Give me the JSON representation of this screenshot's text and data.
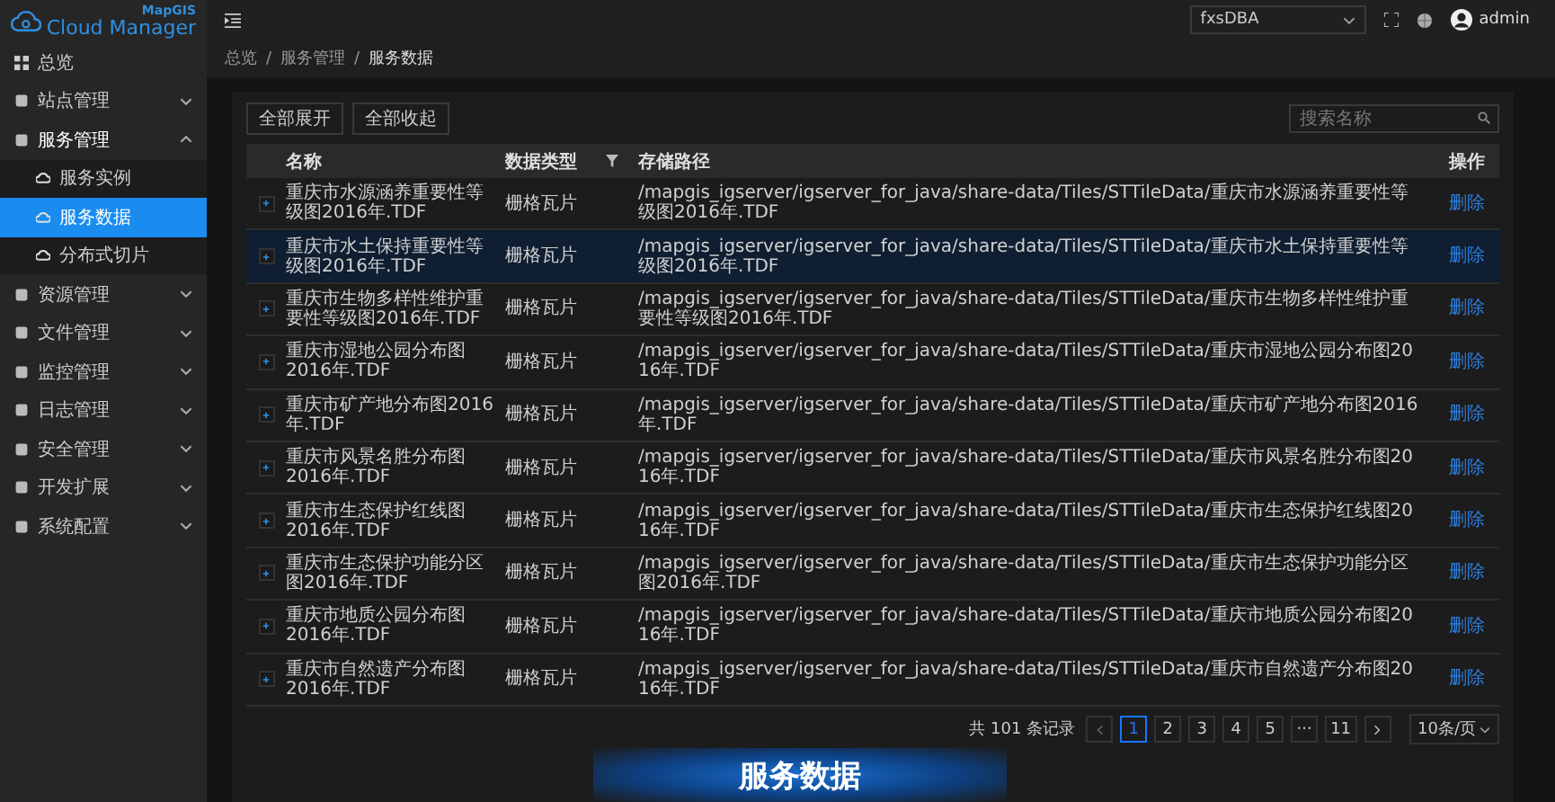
{
  "logo": {
    "brand": "MapGIS",
    "product": "Cloud Manager"
  },
  "sidebar": {
    "items": [
      {
        "label": "总览",
        "selected": false
      },
      {
        "label": "站点管理",
        "expanded": false,
        "selected": false
      },
      {
        "label": "服务管理",
        "expanded": true,
        "selected": false,
        "children": [
          {
            "label": "服务实例",
            "selected": false
          },
          {
            "label": "服务数据",
            "selected": true
          },
          {
            "label": "分布式切片",
            "selected": false
          }
        ]
      },
      {
        "label": "资源管理",
        "expanded": false,
        "selected": false
      },
      {
        "label": "文件管理",
        "expanded": false,
        "selected": false
      },
      {
        "label": "监控管理",
        "expanded": false,
        "selected": false
      },
      {
        "label": "日志管理",
        "expanded": false,
        "selected": false
      },
      {
        "label": "安全管理",
        "expanded": false,
        "selected": false
      },
      {
        "label": "开发扩展",
        "expanded": false,
        "selected": false
      },
      {
        "label": "系统配置",
        "expanded": false,
        "selected": false
      }
    ]
  },
  "header": {
    "select_value": "fxsDBA",
    "user": "admin"
  },
  "breadcrumb": [
    "总览",
    "服务管理",
    "服务数据"
  ],
  "breadcrumb_separator": "/",
  "toolbar": {
    "buttons": [
      "全部展开",
      "全部收起"
    ],
    "search": {
      "placeholder": "搜索名称"
    }
  },
  "table": {
    "columns": [
      "名称",
      "数据类型",
      "存储路径",
      "操作"
    ],
    "rows": [
      {
        "name": "重庆市水源涵养重要性等级图2016年.TDF",
        "type": "栅格瓦片",
        "path": "/mapgis_igserver/igserver_for_java/share-data/Tiles/STTileData/重庆市水源涵养重要性等级图2016年.TDF",
        "action": "删除",
        "selected": false
      },
      {
        "name": "重庆市水土保持重要性等级图2016年.TDF",
        "type": "栅格瓦片",
        "path": "/mapgis_igserver/igserver_for_java/share-data/Tiles/STTileData/重庆市水土保持重要性等级图2016年.TDF",
        "action": "删除",
        "selected": true
      },
      {
        "name": "重庆市生物多样性维护重要性等级图2016年.TDF",
        "type": "栅格瓦片",
        "path": "/mapgis_igserver/igserver_for_java/share-data/Tiles/STTileData/重庆市生物多样性维护重要性等级图2016年.TDF",
        "action": "删除",
        "selected": false
      },
      {
        "name": "重庆市湿地公园分布图2016年.TDF",
        "type": "栅格瓦片",
        "path": "/mapgis_igserver/igserver_for_java/share-data/Tiles/STTileData/重庆市湿地公园分布图2016年.TDF",
        "action": "删除",
        "selected": false
      },
      {
        "name": "重庆市矿产地分布图2016年.TDF",
        "type": "栅格瓦片",
        "path": "/mapgis_igserver/igserver_for_java/share-data/Tiles/STTileData/重庆市矿产地分布图2016年.TDF",
        "action": "删除",
        "selected": false
      },
      {
        "name": "重庆市风景名胜分布图2016年.TDF",
        "type": "栅格瓦片",
        "path": "/mapgis_igserver/igserver_for_java/share-data/Tiles/STTileData/重庆市风景名胜分布图2016年.TDF",
        "action": "删除",
        "selected": false
      },
      {
        "name": "重庆市生态保护红线图2016年.TDF",
        "type": "栅格瓦片",
        "path": "/mapgis_igserver/igserver_for_java/share-data/Tiles/STTileData/重庆市生态保护红线图2016年.TDF",
        "action": "删除",
        "selected": false
      },
      {
        "name": "重庆市生态保护功能分区图2016年.TDF",
        "type": "栅格瓦片",
        "path": "/mapgis_igserver/igserver_for_java/share-data/Tiles/STTileData/重庆市生态保护功能分区图2016年.TDF",
        "action": "删除",
        "selected": false
      },
      {
        "name": "重庆市地质公园分布图2016年.TDF",
        "type": "栅格瓦片",
        "path": "/mapgis_igserver/igserver_for_java/share-data/Tiles/STTileData/重庆市地质公园分布图2016年.TDF",
        "action": "删除",
        "selected": false
      },
      {
        "name": "重庆市自然遗产分布图2016年.TDF",
        "type": "栅格瓦片",
        "path": "/mapgis_igserver/igserver_for_java/share-data/Tiles/STTileData/重庆市自然遗产分布图2016年.TDF",
        "action": "删除",
        "selected": false
      }
    ]
  },
  "pagination": {
    "total": "共 101 条记录",
    "pages": [
      {
        "label": "1",
        "selected": true
      },
      {
        "label": "2",
        "selected": false
      },
      {
        "label": "3",
        "selected": false
      },
      {
        "label": "4",
        "selected": false
      },
      {
        "label": "5",
        "selected": false
      },
      {
        "label": "···",
        "selected": false
      },
      {
        "label": "11",
        "selected": false
      }
    ],
    "page_size": "10条/页"
  },
  "caption": "服务数据"
}
